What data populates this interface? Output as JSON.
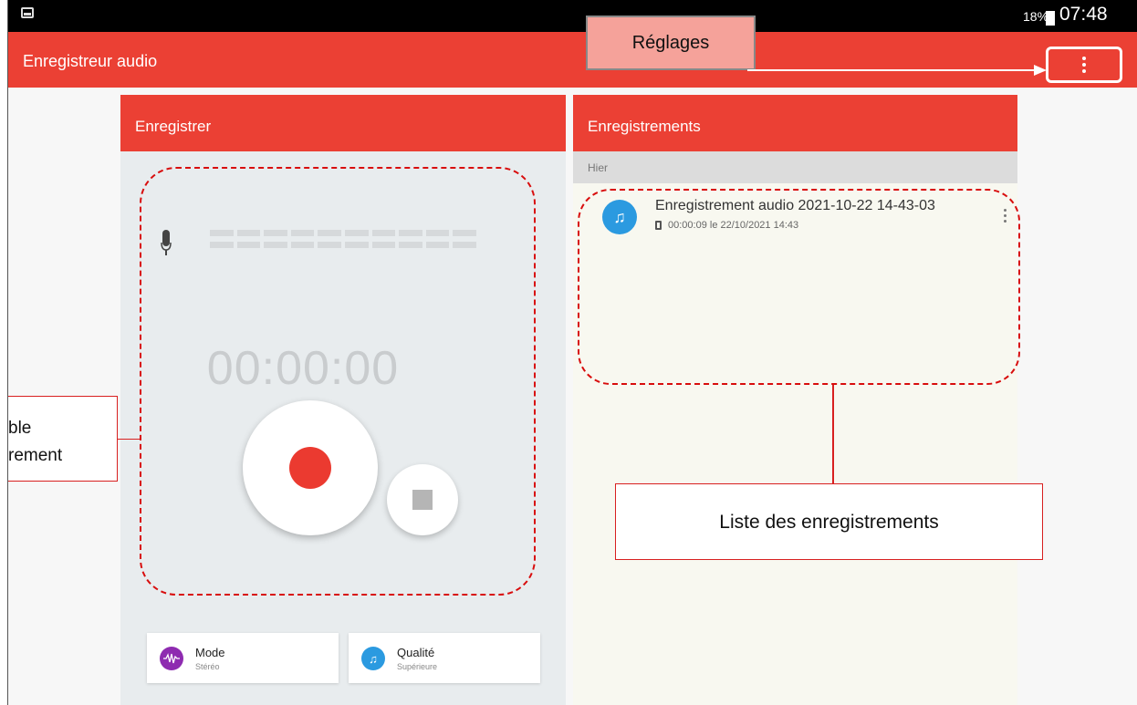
{
  "statusbar": {
    "battery": "18%",
    "time": "07:48"
  },
  "appbar": {
    "title": "Enregistreur audio"
  },
  "recorder": {
    "header": "Enregistrer",
    "timer": "00:00:00",
    "mode": {
      "label": "Mode",
      "value": "Stéréo"
    },
    "quality": {
      "label": "Qualité",
      "value": "Supérieure"
    }
  },
  "recordings": {
    "header": "Enregistrements",
    "section": "Hier",
    "items": [
      {
        "title": "Enregistrement audio 2021-10-22 14-43-03",
        "meta": "00:00:09 le 22/10/2021 14:43"
      }
    ]
  },
  "annotations": {
    "settings": "Réglages",
    "list": "Liste des enregistrements",
    "left_line1": "ble",
    "left_line2": "rement"
  },
  "colors": {
    "accent": "#eb4034",
    "record": "#eb3a30",
    "annotation": "#d80d0d"
  }
}
